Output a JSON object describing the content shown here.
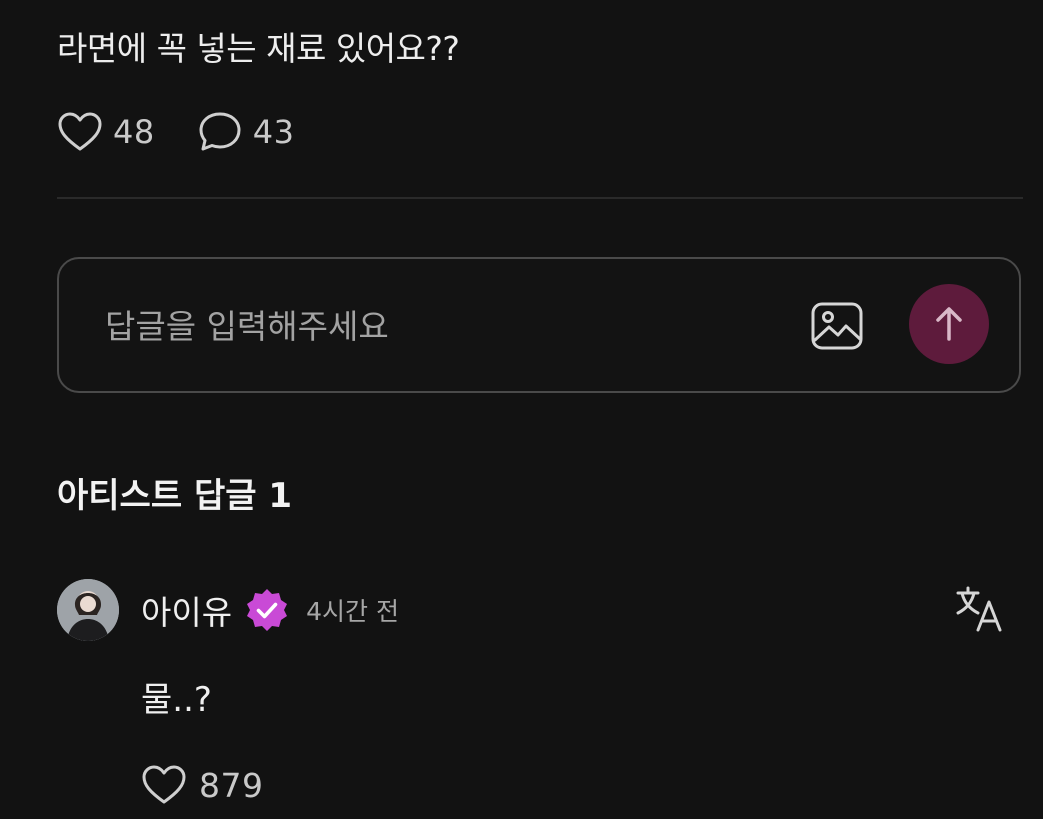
{
  "post": {
    "title": "라면에 꼭 넣는 재료 있어요??",
    "likes": "48",
    "comments": "43"
  },
  "reply": {
    "placeholder": "답글을 입력해주세요"
  },
  "artist_replies": {
    "title": "아티스트 답글 1",
    "items": [
      {
        "author": "아이유",
        "time": "4시간 전",
        "text": "물..?",
        "likes": "879"
      }
    ]
  },
  "icons": {
    "like": "heart-icon",
    "comment": "speech-bubble-icon",
    "image": "image-icon",
    "send": "arrow-up-icon",
    "verified": "verified-badge-icon",
    "translate": "translate-icon"
  },
  "colors": {
    "background": "#121212",
    "send_button": "#5e1b3c",
    "verified_badge": "#c94ad6"
  }
}
